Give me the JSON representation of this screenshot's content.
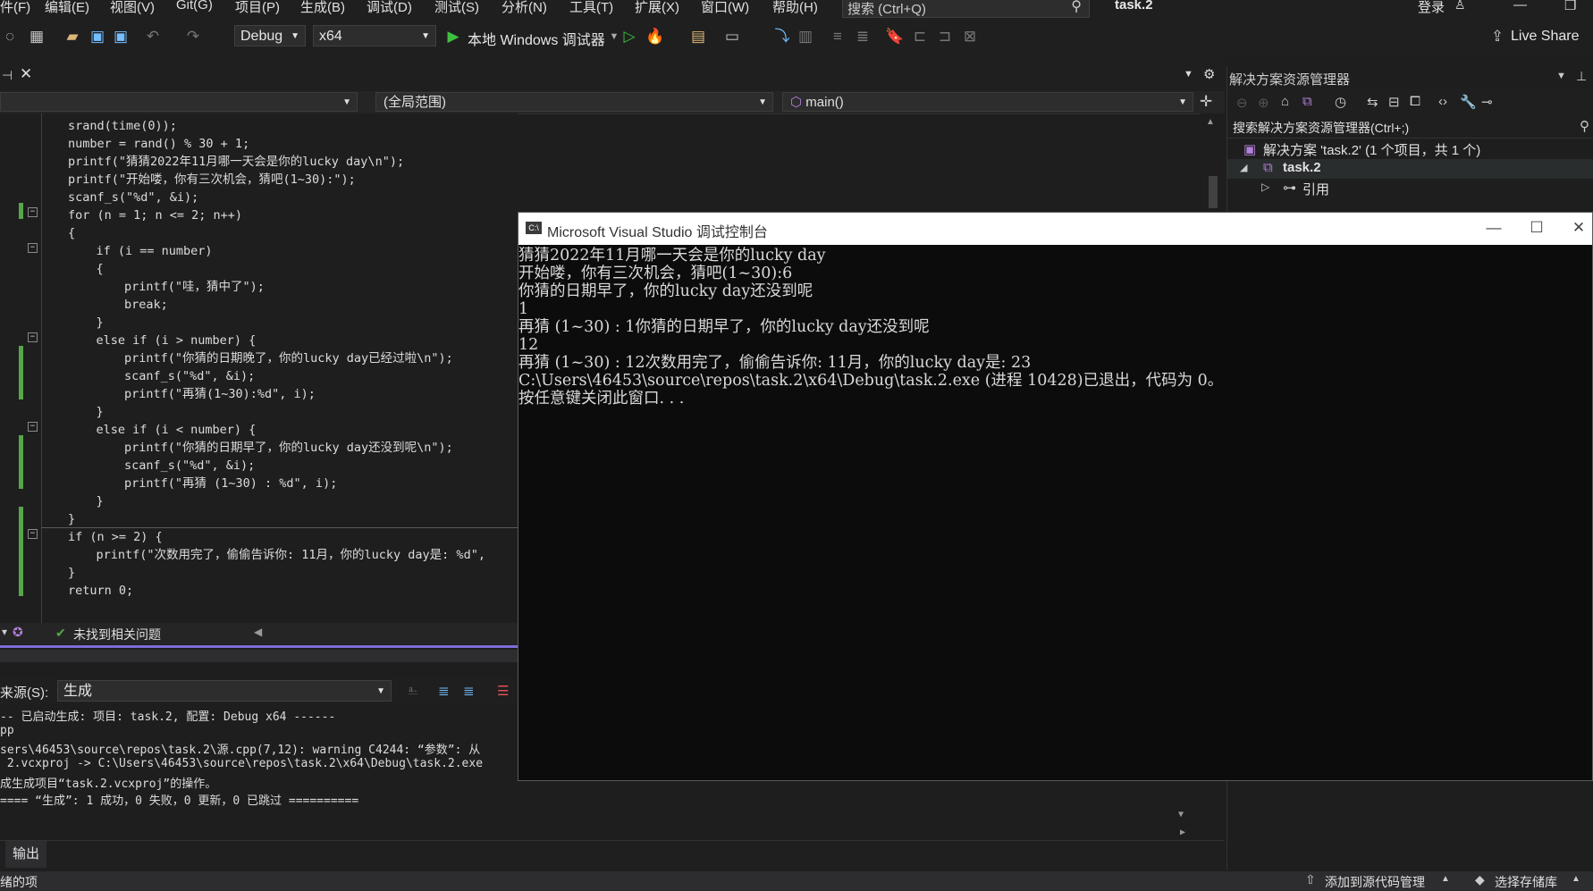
{
  "menu": {
    "items": [
      "件(F)",
      "编辑(E)",
      "视图(V)",
      "Git(G)",
      "项目(P)",
      "生成(B)",
      "调试(D)",
      "测试(S)",
      "分析(N)",
      "工具(T)",
      "扩展(X)",
      "窗口(W)",
      "帮助(H)"
    ],
    "search_placeholder": "搜索 (Ctrl+Q)",
    "project_title": "task.2",
    "login_label": "登录"
  },
  "toolbar": {
    "config": "Debug",
    "platform": "x64",
    "run_label": "本地 Windows 调试器",
    "live_share": "Live Share"
  },
  "editor": {
    "scope_combo": "(全局范围)",
    "func_combo": "main()",
    "status_text": "未找到相关问题"
  },
  "code": [
    {
      "indent": 0,
      "html": ""
    },
    {
      "indent": 0,
      "text": "srand(time(0));"
    },
    {
      "indent": 0,
      "text": "number = rand() % 30 + 1;"
    },
    {
      "indent": 0,
      "text": "printf(\"猜猜2022年11月哪一天会是你的lucky day\\n\");"
    },
    {
      "indent": 0,
      "text": "printf(\"开始喽，你有三次机会，猜吧(1~30):\");"
    },
    {
      "indent": 0,
      "text": "scanf_s(\"%d\", &i);"
    },
    {
      "indent": 0,
      "text": "for (n = 1; n <= 2; n++)"
    },
    {
      "indent": 0,
      "text": "{"
    },
    {
      "indent": 1,
      "text": "if (i == number)"
    },
    {
      "indent": 1,
      "text": "{"
    },
    {
      "indent": 2,
      "text": "printf(\"哇，猜中了\");"
    },
    {
      "indent": 2,
      "text": "break;"
    },
    {
      "indent": 1,
      "text": "}"
    },
    {
      "indent": 1,
      "text": "else if (i > number) {"
    },
    {
      "indent": 2,
      "text": "printf(\"你猜的日期晚了，你的lucky day已经过啦\\n\");"
    },
    {
      "indent": 2,
      "text": "scanf_s(\"%d\", &i);"
    },
    {
      "indent": 2,
      "text": "printf(\"再猜(1~30):%d\", i);"
    },
    {
      "indent": 1,
      "text": "}"
    },
    {
      "indent": 1,
      "text": "else if (i < number) {"
    },
    {
      "indent": 2,
      "text": "printf(\"你猜的日期早了，你的lucky day还没到呢\\n\");"
    },
    {
      "indent": 2,
      "text": "scanf_s(\"%d\", &i);"
    },
    {
      "indent": 2,
      "text": "printf(\"再猜 (1~30) : %d\", i);"
    },
    {
      "indent": 1,
      "text": "}"
    },
    {
      "indent": 0,
      "text": "}"
    },
    {
      "indent": 0,
      "text": "if (n >= 2) {"
    },
    {
      "indent": 1,
      "text": "printf(\"次数用完了，偷偷告诉你: 11月，你的lucky day是: %d\","
    },
    {
      "indent": 0,
      "text": "}"
    },
    {
      "indent": 0,
      "text": "return 0;"
    }
  ],
  "output": {
    "source_label": "来源(S):",
    "source_value": "生成",
    "lines": [
      "-- 已启动生成: 项目: task.2, 配置: Debug x64 ------",
      "pp",
      "sers\\46453\\source\\repos\\task.2\\源.cpp(7,12): warning C4244: “参数”: 从",
      " 2.vcxproj -> C:\\Users\\46453\\source\\repos\\task.2\\x64\\Debug\\task.2.exe",
      "成生成项目“task.2.vcxproj”的操作。",
      "==== “生成”: 1 成功，0 失败，0 更新，0 已跳过 =========="
    ],
    "tab_label": "输出"
  },
  "solution_explorer": {
    "title": "解决方案资源管理器",
    "search": "搜索解决方案资源管理器(Ctrl+;)",
    "solution": "解决方案 'task.2' (1 个项目，共 1 个)",
    "project": "task.2",
    "refs": "引用"
  },
  "console": {
    "title": "Microsoft Visual Studio 调试控制台",
    "lines": [
      "猜猜2022年11月哪一天会是你的lucky day",
      "开始喽，你有三次机会，猜吧(1~30):6",
      "你猜的日期早了，你的lucky day还没到呢",
      "1",
      "再猜 (1~30) : 1你猜的日期早了，你的lucky day还没到呢",
      "12",
      "再猜 (1~30) : 12次数用完了，偷偷告诉你: 11月，你的lucky day是: 23",
      "C:\\Users\\46453\\source\\repos\\task.2\\x64\\Debug\\task.2.exe (进程 10428)已退出，代码为 0。",
      "按任意键关闭此窗口. . ."
    ]
  },
  "statusbar": {
    "left": "绪的项",
    "add_source": "添加到源代码管理",
    "select_repo": "选择存储库"
  }
}
